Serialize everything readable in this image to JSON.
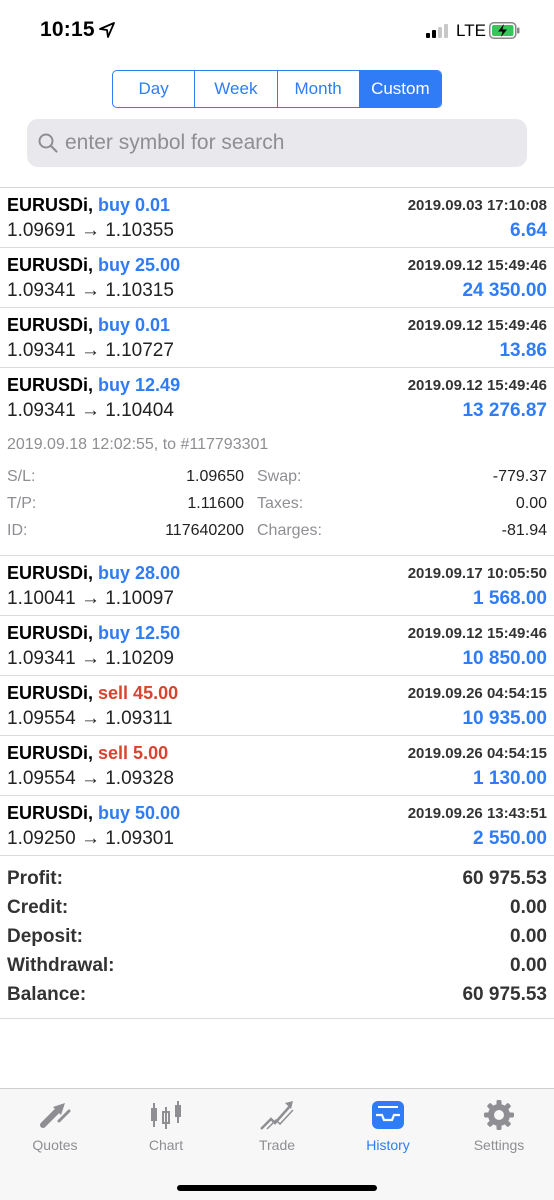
{
  "status_bar": {
    "time": "10:15",
    "network": "LTE",
    "icons": [
      "location-arrow-icon",
      "signal-icon",
      "battery-charging-icon"
    ]
  },
  "period_tabs": [
    {
      "label": "Day",
      "selected": false
    },
    {
      "label": "Week",
      "selected": false
    },
    {
      "label": "Month",
      "selected": false
    },
    {
      "label": "Custom",
      "selected": true
    }
  ],
  "search": {
    "placeholder": "enter symbol for search",
    "value": ""
  },
  "deals_top": [
    {
      "symbol": "EURUSDi,",
      "side": "buy 0.01",
      "type": "buy",
      "datetime": "2019.09.03 17:10:08",
      "prices": "1.09691 → 1.10355",
      "profit": "6.64"
    },
    {
      "symbol": "EURUSDi,",
      "side": "buy 25.00",
      "type": "buy",
      "datetime": "2019.09.12 15:49:46",
      "prices": "1.09341 → 1.10315",
      "profit": "24 350.00"
    },
    {
      "symbol": "EURUSDi,",
      "side": "buy 0.01",
      "type": "buy",
      "datetime": "2019.09.12 15:49:46",
      "prices": "1.09341 → 1.10727",
      "profit": "13.86"
    },
    {
      "symbol": "EURUSDi,",
      "side": "buy 12.49",
      "type": "buy",
      "datetime": "2019.09.12 15:49:46",
      "prices": "1.09341 → 1.10404",
      "profit": "13 276.87"
    }
  ],
  "expanded_detail": {
    "header": "2019.09.18 12:02:55, to #117793301",
    "sl_label": "S/L:",
    "sl_value": "1.09650",
    "tp_label": "T/P:",
    "tp_value": "1.11600",
    "id_label": "ID:",
    "id_value": "117640200",
    "swap_label": "Swap:",
    "swap_value": "-779.37",
    "taxes_label": "Taxes:",
    "taxes_value": "0.00",
    "charges_label": "Charges:",
    "charges_value": "-81.94"
  },
  "deals_bottom": [
    {
      "symbol": "EURUSDi,",
      "side": "buy 28.00",
      "type": "buy",
      "datetime": "2019.09.17 10:05:50",
      "prices": "1.10041 → 1.10097",
      "profit": "1 568.00"
    },
    {
      "symbol": "EURUSDi,",
      "side": "buy 12.50",
      "type": "buy",
      "datetime": "2019.09.12 15:49:46",
      "prices": "1.09341 → 1.10209",
      "profit": "10 850.00"
    },
    {
      "symbol": "EURUSDi,",
      "side": "sell 45.00",
      "type": "sell",
      "datetime": "2019.09.26 04:54:15",
      "prices": "1.09554 → 1.09311",
      "profit": "10 935.00"
    },
    {
      "symbol": "EURUSDi,",
      "side": "sell 5.00",
      "type": "sell",
      "datetime": "2019.09.26 04:54:15",
      "prices": "1.09554 → 1.09328",
      "profit": "1 130.00"
    },
    {
      "symbol": "EURUSDi,",
      "side": "buy 50.00",
      "type": "buy",
      "datetime": "2019.09.26 13:43:51",
      "prices": "1.09250 → 1.09301",
      "profit": "2 550.00"
    }
  ],
  "summary": [
    {
      "label": "Profit:",
      "value": "60 975.53"
    },
    {
      "label": "Credit:",
      "value": "0.00"
    },
    {
      "label": "Deposit:",
      "value": "0.00"
    },
    {
      "label": "Withdrawal:",
      "value": "0.00"
    },
    {
      "label": "Balance:",
      "value": "60 975.53"
    }
  ],
  "tabbar": [
    {
      "label": "Quotes",
      "icon": "quotes-arrows-icon",
      "active": false
    },
    {
      "label": "Chart",
      "icon": "candlestick-chart-icon",
      "active": false
    },
    {
      "label": "Trade",
      "icon": "trade-trend-icon",
      "active": false
    },
    {
      "label": "History",
      "icon": "history-tray-icon",
      "active": true
    },
    {
      "label": "Settings",
      "icon": "gear-icon",
      "active": false
    }
  ],
  "colors": {
    "accent": "#2f7cf6",
    "sell": "#d9432f",
    "muted": "#8e8e93"
  }
}
